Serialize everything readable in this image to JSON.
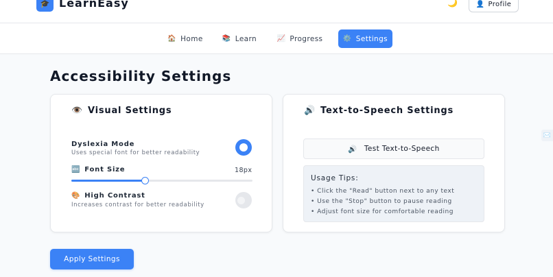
{
  "header": {
    "brand_icon": "🎓",
    "brand": "LearnEasy",
    "theme_icon": "🌙",
    "profile_icon": "👤",
    "profile_label": "Profile"
  },
  "nav": {
    "items": [
      {
        "icon": "🏠",
        "label": "Home",
        "active": false
      },
      {
        "icon": "📚",
        "label": "Learn",
        "active": false
      },
      {
        "icon": "📈",
        "label": "Progress",
        "active": false
      },
      {
        "icon": "⚙️",
        "label": "Settings",
        "active": true
      }
    ]
  },
  "page": {
    "title": "Accessibility Settings"
  },
  "visual": {
    "icon": "👁️",
    "title": "Visual Settings",
    "dyslexia_label": "Dyslexia Mode",
    "dyslexia_desc": "Uses special font for better readability",
    "dyslexia_on": true,
    "font_icon": "🔤",
    "font_label": "Font Size",
    "font_value": "18px",
    "font_slider_fraction": 0.405,
    "contrast_icon": "🎨",
    "contrast_label": "High Contrast",
    "contrast_desc": "Increases contrast for better readability",
    "contrast_on": false
  },
  "tts": {
    "icon": "🔊",
    "title": "Text-to-Speech Settings",
    "test_icon": "🔊",
    "test_label": "Test Text-to-Speech",
    "tips_title": "Usage Tips:",
    "tips": [
      "• Click the \"Read\" button next to any text",
      "• Use the \"Stop\" button to pause reading",
      "• Adjust font size for comfortable reading"
    ]
  },
  "actions": {
    "apply_label": "Apply Settings"
  },
  "side_widget_icon": "✉️",
  "colors": {
    "accent": "#3b82f6",
    "background": "#f8fafc",
    "card": "#ffffff"
  }
}
